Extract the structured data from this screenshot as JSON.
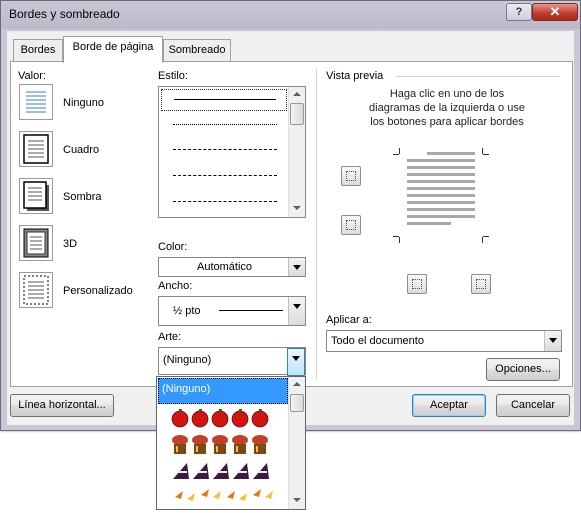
{
  "window": {
    "title": "Bordes y sombreado"
  },
  "controls": {
    "help": "?",
    "close": "✕"
  },
  "tabs": [
    {
      "label": "Bordes"
    },
    {
      "label": "Borde de página"
    },
    {
      "label": "Sombreado"
    }
  ],
  "setting": {
    "label": "Valor:",
    "options": [
      {
        "label": "Ninguno"
      },
      {
        "label": "Cuadro"
      },
      {
        "label": "Sombra"
      },
      {
        "label": "3D"
      },
      {
        "label": "Personalizado"
      }
    ]
  },
  "style": {
    "label": "Estilo:"
  },
  "color": {
    "label": "Color:",
    "value": "Automático"
  },
  "width": {
    "label": "Ancho:",
    "value": "½ pto"
  },
  "art": {
    "label": "Arte:",
    "value": "(Ninguno)",
    "list_selected": "(Ninguno)"
  },
  "preview": {
    "label": "Vista previa",
    "hint": "Haga clic en uno de los diagramas de la izquierda o use los botones para aplicar bordes"
  },
  "apply_to": {
    "label": "Aplicar a:",
    "value": "Todo el documento"
  },
  "buttons": {
    "options": "Opciones...",
    "horizontal_line": "Línea horizontal...",
    "accept": "Aceptar",
    "cancel": "Cancelar"
  },
  "colors": {
    "accent": "#3399ff",
    "selection": "#3399ff"
  }
}
